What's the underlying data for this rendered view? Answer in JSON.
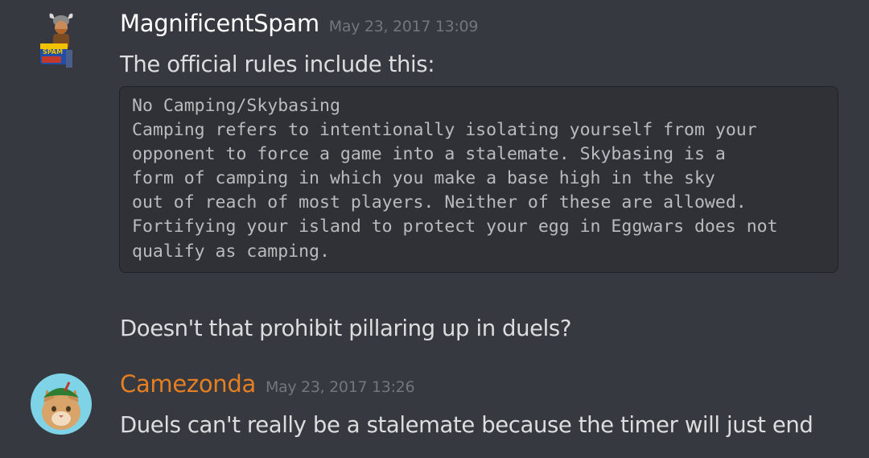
{
  "messages": [
    {
      "author": "MagnificentSpam",
      "author_color": "#ffffff",
      "timestamp": "May 23, 2017 13:09",
      "avatar_icon": "viking-spam-can-avatar",
      "lines": [
        "The official rules include this:"
      ],
      "code_block": [
        "No Camping/Skybasing",
        "Camping refers to intentionally isolating yourself from your",
        "opponent to force a game into a stalemate. Skybasing is a",
        "form of camping in which you make a base high in the sky",
        "out of reach of most players. Neither of these are allowed.",
        "Fortifying your island to protect your egg in Eggwars does not",
        "qualify as camping."
      ],
      "followup": "Doesn't that prohibit pillaring up in duels?"
    },
    {
      "author": "Camezonda",
      "author_color": "#e67e22",
      "timestamp": "May 23, 2017 13:26",
      "avatar_icon": "cat-with-green-hat-avatar",
      "lines": [
        "Duels can't really be a stalemate because the timer will just end"
      ]
    }
  ]
}
